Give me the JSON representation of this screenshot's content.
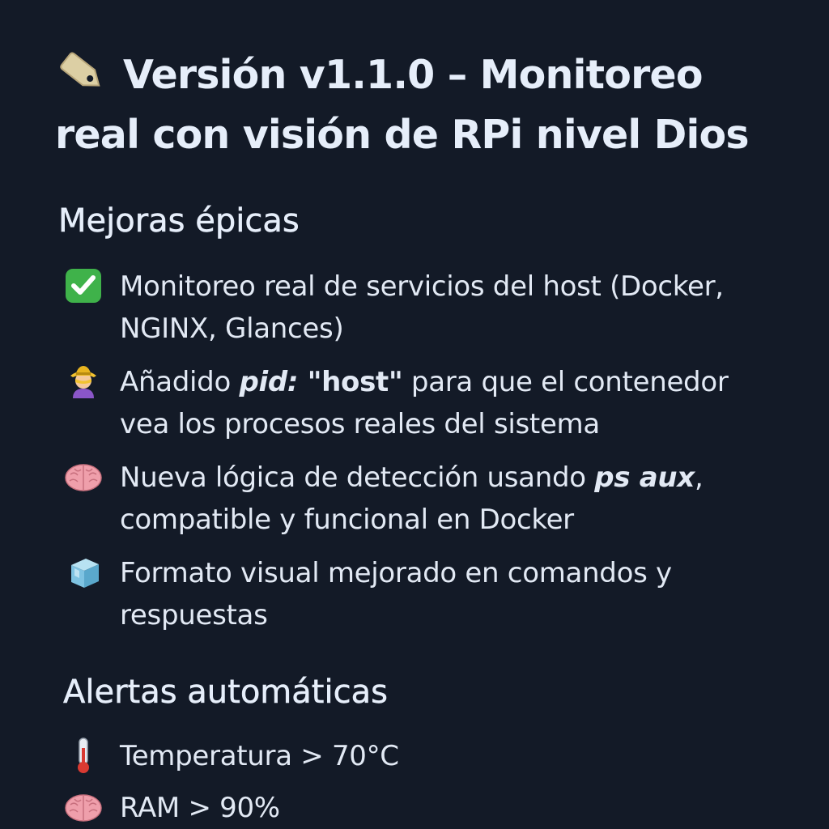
{
  "title": "Versión v1.1.0 – Monitoreo real con visión de RPi nivel Dios",
  "improvements": {
    "heading": "Mejoras épicas",
    "items": [
      {
        "icon": "check-mark-icon",
        "text": "Monitoreo real de servicios del host (Docker, NGINX, Glances)"
      },
      {
        "icon": "detective-icon",
        "before": "Añadido ",
        "code_key": "pid:",
        "code_value": " \"host\"",
        "after": " para que el contenedor vea los procesos reales del sistema"
      },
      {
        "icon": "brain-icon",
        "before": "Nueva lógica de detección usando ",
        "code": "ps aux",
        "after": ", compatible y funcional en Docker"
      },
      {
        "icon": "ice-cube-icon",
        "text": "Formato visual mejorado en comandos y respuestas"
      }
    ]
  },
  "alerts": {
    "heading": "Alertas automáticas",
    "items": [
      {
        "icon": "thermometer-icon",
        "text": "Temperatura > 70°C"
      },
      {
        "icon": "brain-icon",
        "text": "RAM > 90%"
      }
    ]
  },
  "colors": {
    "background": "#131a27",
    "text": "#e4ebf6",
    "check_green": "#3fb24a",
    "tag_beige": "#dccfa4",
    "brain_pink": "#ef9fab",
    "ice_blue": "#7fc3e2",
    "detective_yellow": "#f2c230",
    "thermometer_red": "#d93a32"
  }
}
